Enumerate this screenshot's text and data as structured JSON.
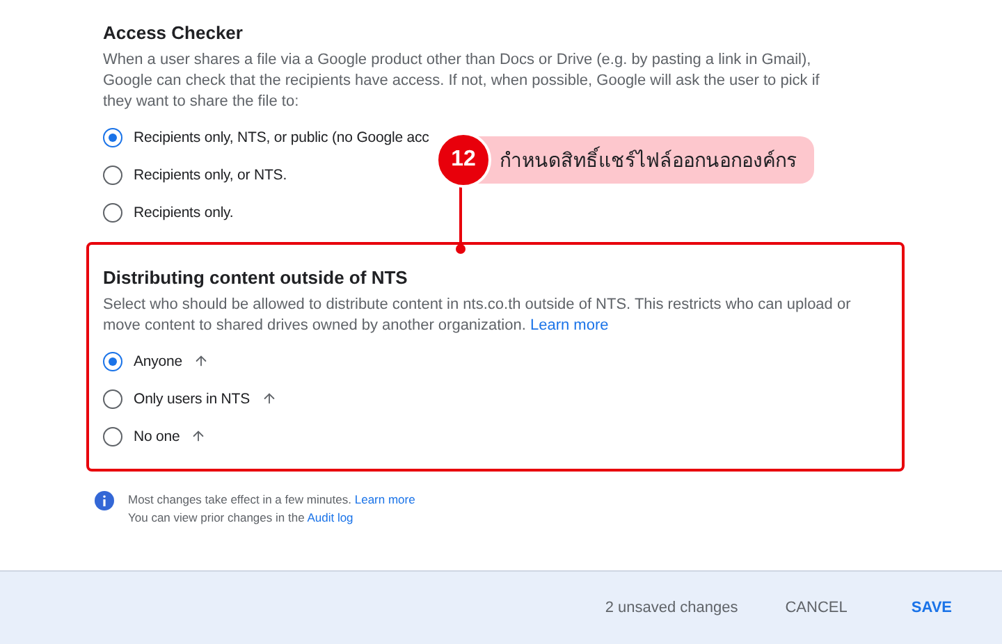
{
  "access_checker": {
    "title": "Access Checker",
    "description": "When a user shares a file via a Google product other than Docs or Drive (e.g. by pasting a link in Gmail), Google can check that the recipients have access. If not, when possible, Google will ask the user to pick if they want to share the file to:",
    "options": [
      {
        "label": "Recipients only, NTS, or public (no Google acc",
        "selected": true
      },
      {
        "label": "Recipients only, or NTS.",
        "selected": false
      },
      {
        "label": "Recipients only.",
        "selected": false
      }
    ]
  },
  "callout": {
    "number": "12",
    "text": "กำหนดสิทธิ์แชร์ไฟล์ออกนอกองค์กร"
  },
  "distributing": {
    "title": "Distributing content outside of NTS",
    "description": "Select who should be allowed to distribute content in nts.co.th outside of NTS. This restricts who can upload or move content to shared drives owned by another organization.",
    "link": "Learn more",
    "options": [
      {
        "label": "Anyone",
        "selected": true
      },
      {
        "label": "Only users in NTS",
        "selected": false
      },
      {
        "label": "No one",
        "selected": false
      }
    ]
  },
  "info": {
    "line_1": "Most changes take effect in a few minutes.",
    "link_1": "Learn more",
    "line_2": "You can view prior changes in the",
    "link_2": "Audit log"
  },
  "footer": {
    "status": "2 unsaved changes",
    "buttons": [
      {
        "label": "CANCEL",
        "kind": "secondary"
      },
      {
        "label": "SAVE",
        "kind": "primary"
      }
    ]
  }
}
